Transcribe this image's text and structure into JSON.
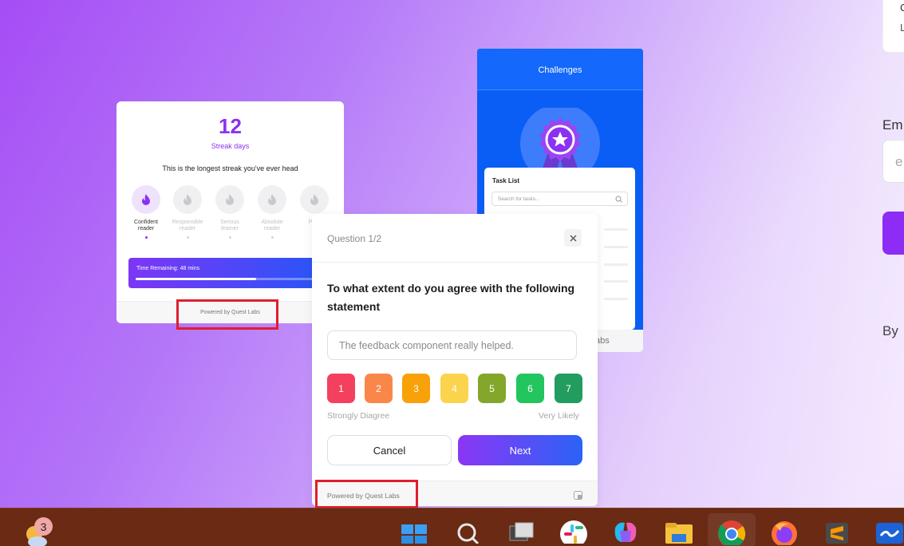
{
  "streak_card": {
    "count": "12",
    "label": "Streak days",
    "message": "This is the longest streak you've ever head",
    "badges": [
      {
        "line1": "Confident",
        "line2": "reader",
        "active": true
      },
      {
        "line1": "Responsible",
        "line2": "reader",
        "active": false
      },
      {
        "line1": "Serious",
        "line2": "learner",
        "active": false
      },
      {
        "line1": "Absolute",
        "line2": "reader",
        "active": false
      },
      {
        "line1": "Profi",
        "line2": "re",
        "active": false
      }
    ],
    "time_remaining": "Time Remaining: 48 mins",
    "time_progress": 0.68,
    "powered_by": "Powered by Quest Labs"
  },
  "challenges_card": {
    "title": "Challenges",
    "task_list_title": "Task List",
    "search_placeholder": "Search for tasks...",
    "footer_text": "abs"
  },
  "question_card": {
    "header": "Question 1/2",
    "statement": "To what extent do you agree with the following statement",
    "input_placeholder": "The feedback component really helped.",
    "ratings": [
      {
        "value": "1",
        "color": "#f43f5e"
      },
      {
        "value": "2",
        "color": "#f9874a"
      },
      {
        "value": "3",
        "color": "#f9a109"
      },
      {
        "value": "4",
        "color": "#fcd34d"
      },
      {
        "value": "5",
        "color": "#84a62b"
      },
      {
        "value": "6",
        "color": "#22c55e"
      },
      {
        "value": "7",
        "color": "#239c5f"
      }
    ],
    "scale_min_label": "Strongly Diagree",
    "scale_max_label": "Very Likely",
    "cancel_label": "Cancel",
    "next_label": "Next",
    "powered_by": "Powered by Quest Labs"
  },
  "right_page": {
    "top_text_1": "C",
    "top_text_2": "L",
    "email_label": "Em",
    "email_placeholder": "e",
    "by_text": "By"
  },
  "taskbar": {
    "weather_badge": "3",
    "apps": [
      "start-icon",
      "search-icon",
      "task-view-icon",
      "slack-icon",
      "copilot-icon",
      "file-explorer-icon",
      "chrome-icon",
      "firefox-icon",
      "sublime-text-icon",
      "whiteboard-icon"
    ]
  },
  "colors": {
    "accent_purple": "#8b31f2",
    "accent_blue": "#2b63f7",
    "taskbar_bg": "#6a2a14",
    "highlight_red": "#e01e2e"
  }
}
